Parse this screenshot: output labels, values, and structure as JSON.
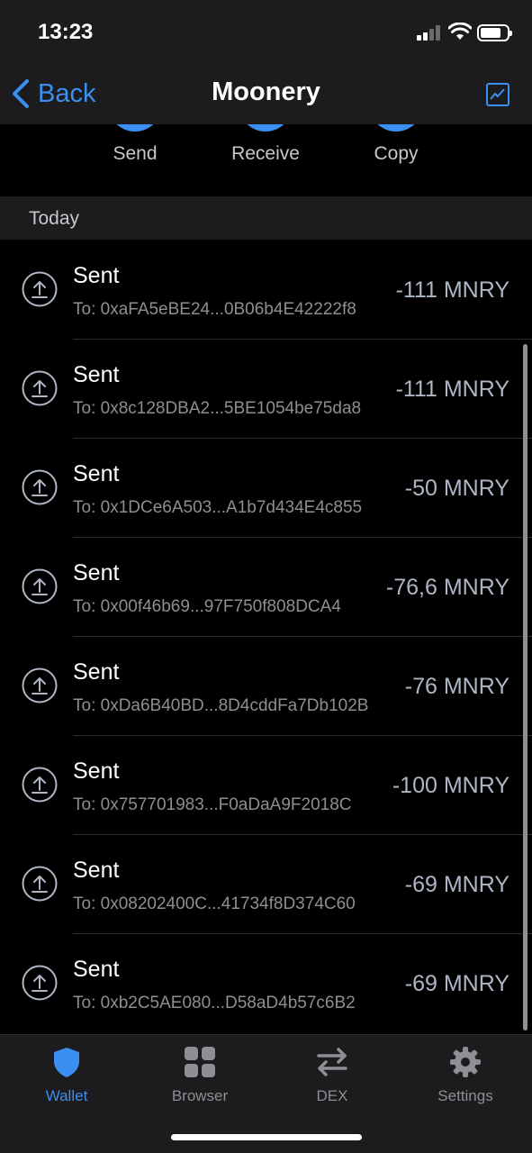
{
  "status_bar": {
    "time": "13:23"
  },
  "nav": {
    "back_label": "Back",
    "title": "Moonery"
  },
  "actions": [
    {
      "label": "Send"
    },
    {
      "label": "Receive"
    },
    {
      "label": "Copy"
    }
  ],
  "section": {
    "title": "Today"
  },
  "transactions": [
    {
      "title": "Sent",
      "address": "To: 0xaFA5eBE24...0B06b4E42222f8",
      "amount": "-111 MNRY"
    },
    {
      "title": "Sent",
      "address": "To: 0x8c128DBA2...5BE1054be75da8",
      "amount": "-111 MNRY"
    },
    {
      "title": "Sent",
      "address": "To: 0x1DCe6A503...A1b7d434E4c855",
      "amount": "-50 MNRY"
    },
    {
      "title": "Sent",
      "address": "To: 0x00f46b69...97F750f808DCA4",
      "amount": "-76,6 MNRY"
    },
    {
      "title": "Sent",
      "address": "To: 0xDa6B40BD...8D4cddFa7Db102B",
      "amount": "-76 MNRY"
    },
    {
      "title": "Sent",
      "address": "To: 0x757701983...F0aDaA9F2018C",
      "amount": "-100 MNRY"
    },
    {
      "title": "Sent",
      "address": "To: 0x08202400C...41734f8D374C60",
      "amount": "-69 MNRY"
    },
    {
      "title": "Sent",
      "address": "To: 0xb2C5AE080...D58aD4b57c6B2",
      "amount": "-69 MNRY"
    }
  ],
  "tabs": [
    {
      "label": "Wallet",
      "icon": "shield-icon",
      "active": true
    },
    {
      "label": "Browser",
      "icon": "grid-icon",
      "active": false
    },
    {
      "label": "DEX",
      "icon": "swap-icon",
      "active": false
    },
    {
      "label": "Settings",
      "icon": "gear-icon",
      "active": false
    }
  ],
  "colors": {
    "accent": "#3b8ff0",
    "bar_background": "#1c1c1e",
    "amount": "#aeb6c4",
    "secondary_text": "#8e8e93",
    "inactive_tab": "#8e8e93"
  }
}
